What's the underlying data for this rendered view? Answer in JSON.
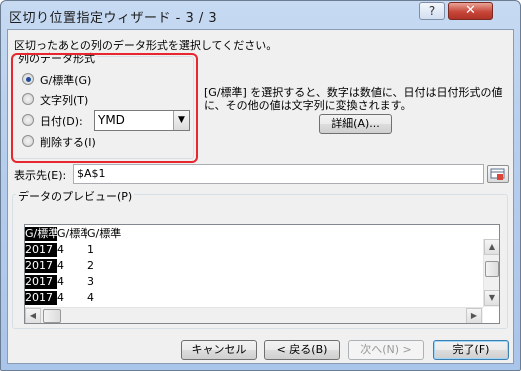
{
  "window": {
    "title": "区切り位置指定ウィザード - 3 / 3",
    "help_label": "?",
    "close_label": "✕"
  },
  "instruction": "区切ったあとの列のデータ形式を選択してください。",
  "format_group": {
    "legend": "列のデータ形式",
    "options": [
      {
        "label": "G/標準(G)",
        "checked": true
      },
      {
        "label": "文字列(T)",
        "checked": false
      },
      {
        "label": "日付(D):",
        "checked": false
      },
      {
        "label": "削除する(I)",
        "checked": false
      }
    ],
    "date_format_value": "YMD"
  },
  "description_line1": "[G/標準] を選択すると、数字は数値に、日付は日付形式の値",
  "description_line2": "に、その他の値は文字列に変換されます。",
  "advanced_button": "詳細(A)...",
  "destination": {
    "label": "表示先(E):",
    "value": "$A$1"
  },
  "preview": {
    "legend": "データのプレビュー(P)",
    "headers": [
      "G/標準",
      "G/標準",
      "G/標準"
    ],
    "rows": [
      [
        "2017",
        "4",
        "1"
      ],
      [
        "2017",
        "4",
        "2"
      ],
      [
        "2017",
        "4",
        "3"
      ],
      [
        "2017",
        "4",
        "4"
      ]
    ]
  },
  "buttons": {
    "cancel": "キャンセル",
    "back": "< 戻る(B)",
    "next": "次へ(N) >",
    "finish": "完了(F)"
  }
}
